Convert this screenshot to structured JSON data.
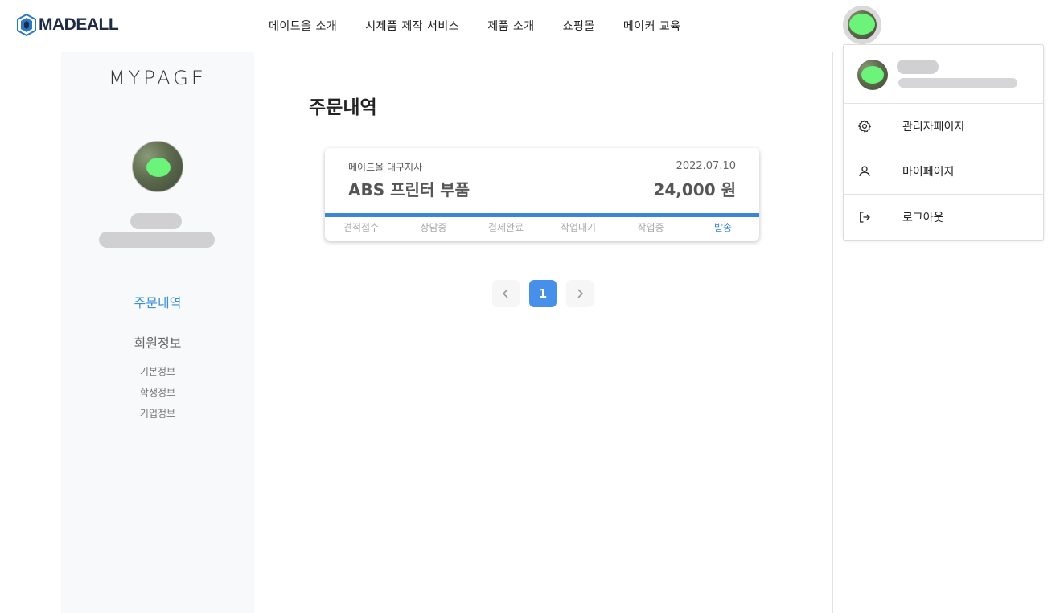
{
  "header": {
    "logo_text": "MADEALL",
    "nav": [
      "메이드올 소개",
      "시제품 제작 서비스",
      "제품 소개",
      "쇼핑몰",
      "메이커 교육"
    ]
  },
  "sidebar": {
    "title": "MYPAGE",
    "orders_link": "주문내역",
    "member_info": "회원정보",
    "sub_links": [
      "기본정보",
      "학생정보",
      "기업정보"
    ]
  },
  "main": {
    "title": "주문내역",
    "order": {
      "branch": "메이드올 대구지사",
      "date": "2022.07.10",
      "product": "ABS 프린터 부품",
      "price": "24,000 원",
      "steps": [
        "견적접수",
        "상담중",
        "결제완료",
        "작업대기",
        "작업중",
        "발송"
      ],
      "active_step": "발송"
    },
    "pagination": {
      "prev_icon": "chevron-left-icon",
      "current": "1",
      "next_icon": "chevron-right-icon"
    }
  },
  "dropdown": {
    "items": [
      "관리자페이지",
      "마이페이지",
      "로그아웃"
    ],
    "icons": [
      "gear-icon",
      "user-icon",
      "logout-icon"
    ]
  },
  "colors": {
    "accent": "#3b86d8",
    "active_page": "#4690ea",
    "sidebar_bg": "#f8f9fb",
    "logo": "#1d2b44"
  }
}
